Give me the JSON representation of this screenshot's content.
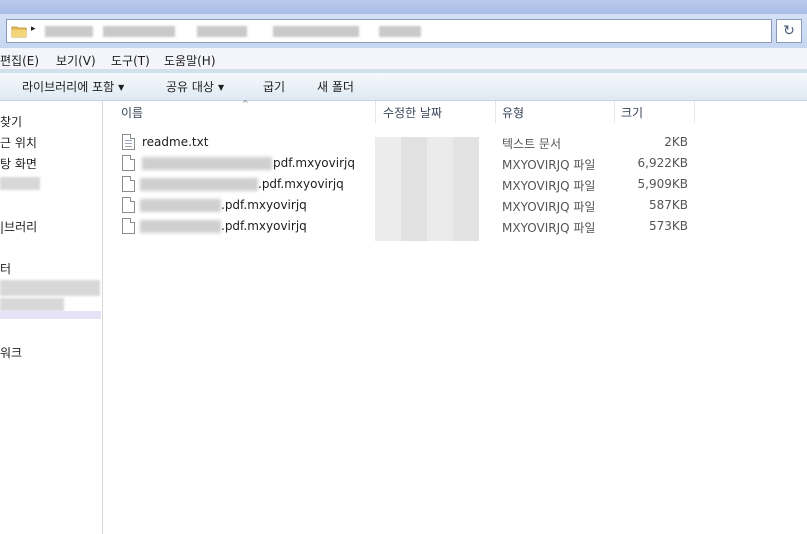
{
  "address": {
    "folder_icon": "folder-icon",
    "arrow": "▸",
    "refresh_icon": "refresh-icon",
    "refresh_glyph": "↻"
  },
  "menu": {
    "items": [
      {
        "label": "편집(E)"
      },
      {
        "label": "보기(V)"
      },
      {
        "label": "도구(T)"
      },
      {
        "label": "도움말(H)"
      }
    ]
  },
  "toolbar": {
    "include_library": "라이브러리에 포함",
    "share_with": "공유 대상",
    "burn": "굽기",
    "new_folder": "새 폴더",
    "caret": "▼"
  },
  "nav": {
    "items": [
      {
        "label": "찾기"
      },
      {
        "label": "근 위치"
      },
      {
        "label": "탕 화면"
      },
      {
        "label": "|브러리"
      },
      {
        "label": "터"
      },
      {
        "label": "워크"
      }
    ]
  },
  "columns": {
    "name": "이름",
    "modified": "수정한 날짜",
    "type": "유형",
    "size": "크기",
    "sort_indicator": "^"
  },
  "files": [
    {
      "name": "readme.txt",
      "type": "텍스트 문서",
      "size": "2KB",
      "icon": "text-file-icon"
    },
    {
      "name": "pdf.mxyovirjq",
      "type": "MXYOVIRJQ 파일",
      "size": "6,922KB",
      "icon": "file-icon"
    },
    {
      "name": ".pdf.mxyovirjq",
      "type": "MXYOVIRJQ 파일",
      "size": "5,909KB",
      "icon": "file-icon"
    },
    {
      "name": ".pdf.mxyovirjq",
      "type": "MXYOVIRJQ 파일",
      "size": "587KB",
      "icon": "file-icon"
    },
    {
      "name": ".pdf.mxyovirjq",
      "type": "MXYOVIRJQ 파일",
      "size": "573KB",
      "icon": "file-icon"
    }
  ],
  "colors": {
    "titlebar": "#b9c9ea",
    "selection": "#e7e3f7"
  }
}
